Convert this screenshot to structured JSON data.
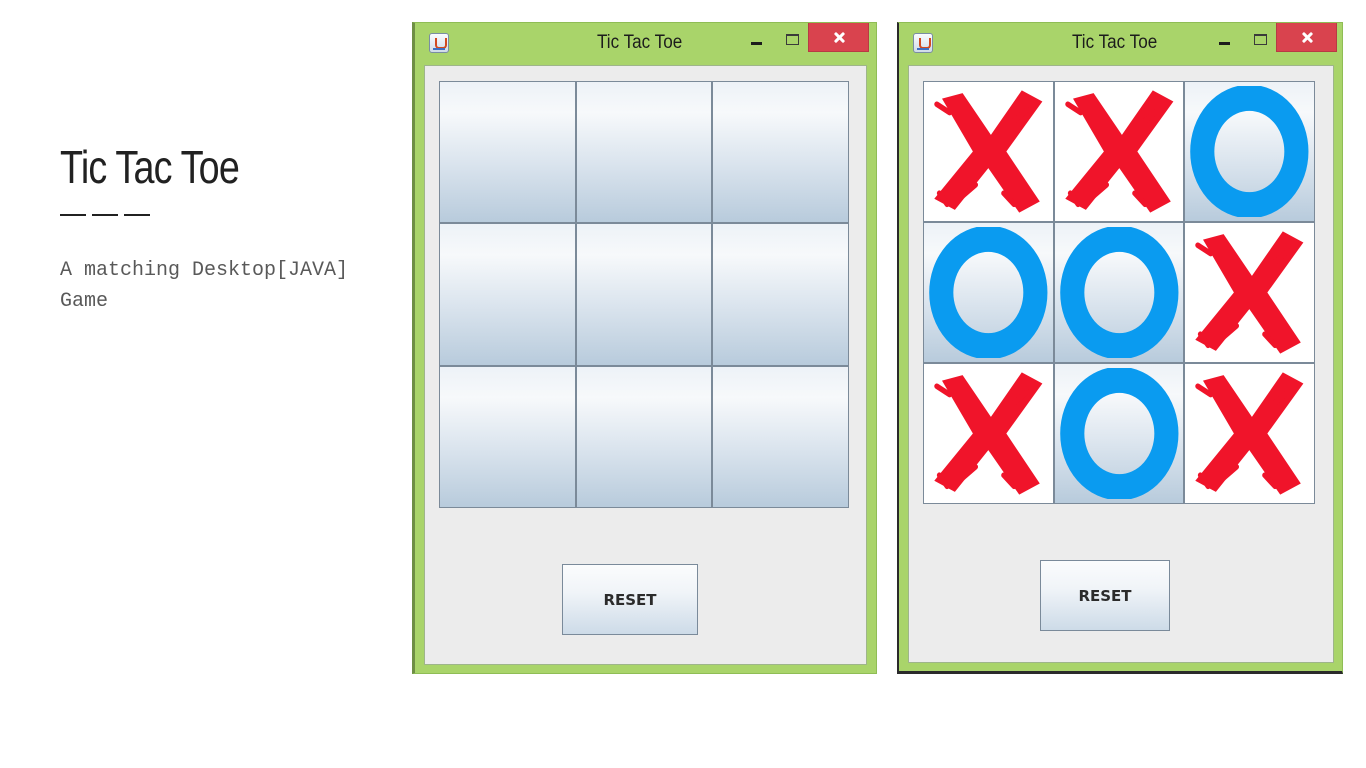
{
  "slide": {
    "title": "Tic Tac Toe",
    "subtitle": "A matching Desktop[JAVA] Game"
  },
  "windows": [
    {
      "title": "Tic Tac Toe",
      "icon": "java-app-icon",
      "controls": {
        "minimize": "minimize-icon",
        "maximize": "maximize-icon",
        "close": "close-icon"
      },
      "board": [
        "",
        "",
        "",
        "",
        "",
        "",
        "",
        "",
        ""
      ],
      "reset_label": "RESET"
    },
    {
      "title": "Tic Tac Toe",
      "icon": "java-app-icon",
      "controls": {
        "minimize": "minimize-icon",
        "maximize": "maximize-icon",
        "close": "close-icon"
      },
      "board": [
        "X",
        "X",
        "O",
        "O",
        "O",
        "X",
        "X",
        "O",
        "X"
      ],
      "reset_label": "RESET"
    }
  ],
  "colors": {
    "titlebar": "#a9d46a",
    "close_button": "#d9434e",
    "x_mark": "#f0142a",
    "o_mark": "#0a9bf0",
    "client_bg": "#ececec"
  }
}
